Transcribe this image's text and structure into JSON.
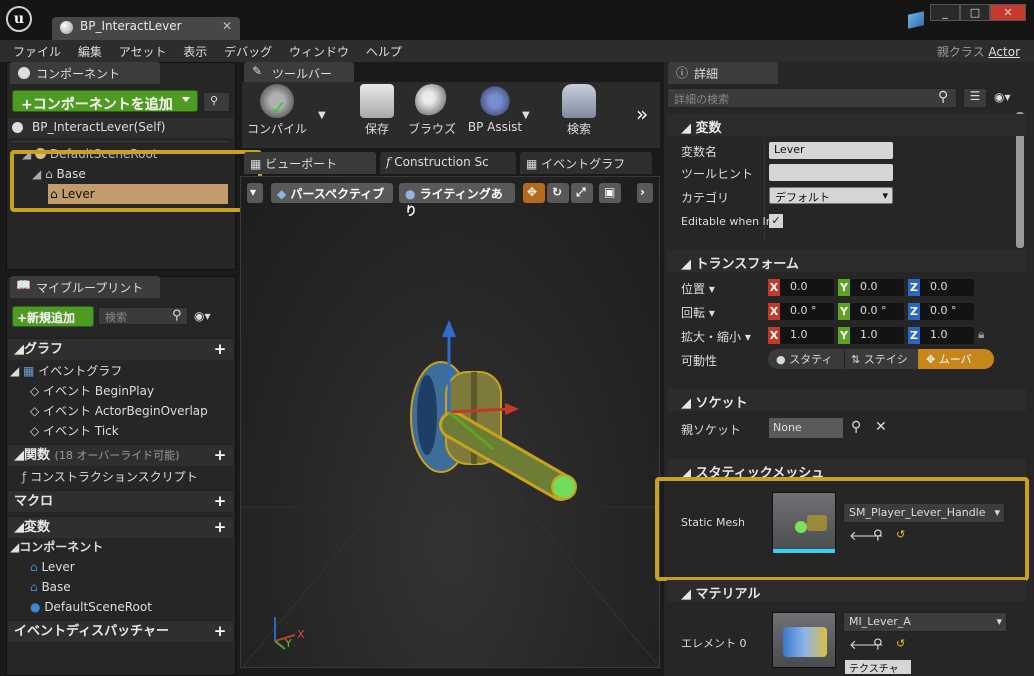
{
  "window": {
    "tab_title": "BP_InteractLever",
    "buttons": [
      "_",
      "□",
      "✕"
    ]
  },
  "menu": [
    "ファイル",
    "編集",
    "アセット",
    "表示",
    "デバッグ",
    "ウィンドウ",
    "ヘルプ"
  ],
  "parent_class": {
    "label": "親クラス",
    "value": "Actor"
  },
  "components_panel": {
    "tab": "コンポーネント",
    "add_button": "+コンポーネントを追加",
    "self_item": "BP_InteractLever(Self)",
    "tree": [
      "DefaultSceneRoot",
      "Base",
      "Lever"
    ]
  },
  "my_blueprint": {
    "tab": "マイブループリント",
    "add_new": "+新規追加",
    "search_placeholder": "検索",
    "graph_section": "グラフ",
    "event_graph": "イベントグラフ",
    "events": [
      "イベント BeginPlay",
      "イベント ActorBeginOverlap",
      "イベント Tick"
    ],
    "functions_section": "関数",
    "functions_note": "(18 オーバーライド可能)",
    "construction_script": "コンストラクションスクリプト",
    "macros_section": "マクロ",
    "variables_section": "変数",
    "components_section": "コンポーネント",
    "components": [
      "Lever",
      "Base",
      "DefaultSceneRoot"
    ],
    "dispatchers_section": "イベントディスパッチャー"
  },
  "toolbar": {
    "tab": "ツールバー",
    "compile": "コンパイル",
    "save": "保存",
    "browse": "ブラウズ",
    "bp_assist": "BP Assist",
    "find": "検索"
  },
  "viewport": {
    "tabs": [
      "ビューポート",
      "Construction Sc",
      "イベントグラフ"
    ],
    "perspective": "パースペクティブ",
    "lighting": "ライティングあり",
    "axis_x": "X",
    "axis_y": "Y"
  },
  "details": {
    "tab": "詳細",
    "search_placeholder": "詳細の検索",
    "variable_section": "変数",
    "var_name_label": "変数名",
    "var_name": "Lever",
    "tooltip_label": "ツールヒント",
    "tooltip_value": "",
    "category_label": "カテゴリ",
    "category_value": "デフォルト",
    "editable_label": "Editable when Inl",
    "transform_section": "トランスフォーム",
    "location_label": "位置",
    "location": [
      "0.0",
      "0.0",
      "0.0"
    ],
    "rotation_label": "回転",
    "rotation": [
      "0.0 °",
      "0.0 °",
      "0.0 °"
    ],
    "scale_label": "拡大・縮小",
    "scale": [
      "1.0",
      "1.0",
      "1.0"
    ],
    "mobility_label": "可動性",
    "mobility_options": [
      "スタティ",
      "ステイシ",
      "ムーバ"
    ],
    "socket_section": "ソケット",
    "parent_socket_label": "親ソケット",
    "parent_socket_value": "None",
    "static_mesh_section": "スタティックメッシュ",
    "static_mesh_label": "Static Mesh",
    "static_mesh_value": "SM_Player_Lever_Handle",
    "material_section": "マテリアル",
    "element_label": "エレメント 0",
    "material_value": "MI_Lever_A",
    "texture_label": "テクスチャー"
  },
  "colors": {
    "highlight": "#c8a21e",
    "green_button": "#4f9a24",
    "x_axis": "#c33a2a",
    "y_axis": "#5ea322",
    "z_axis": "#2c66c4",
    "movable_selected": "#c8851a"
  }
}
